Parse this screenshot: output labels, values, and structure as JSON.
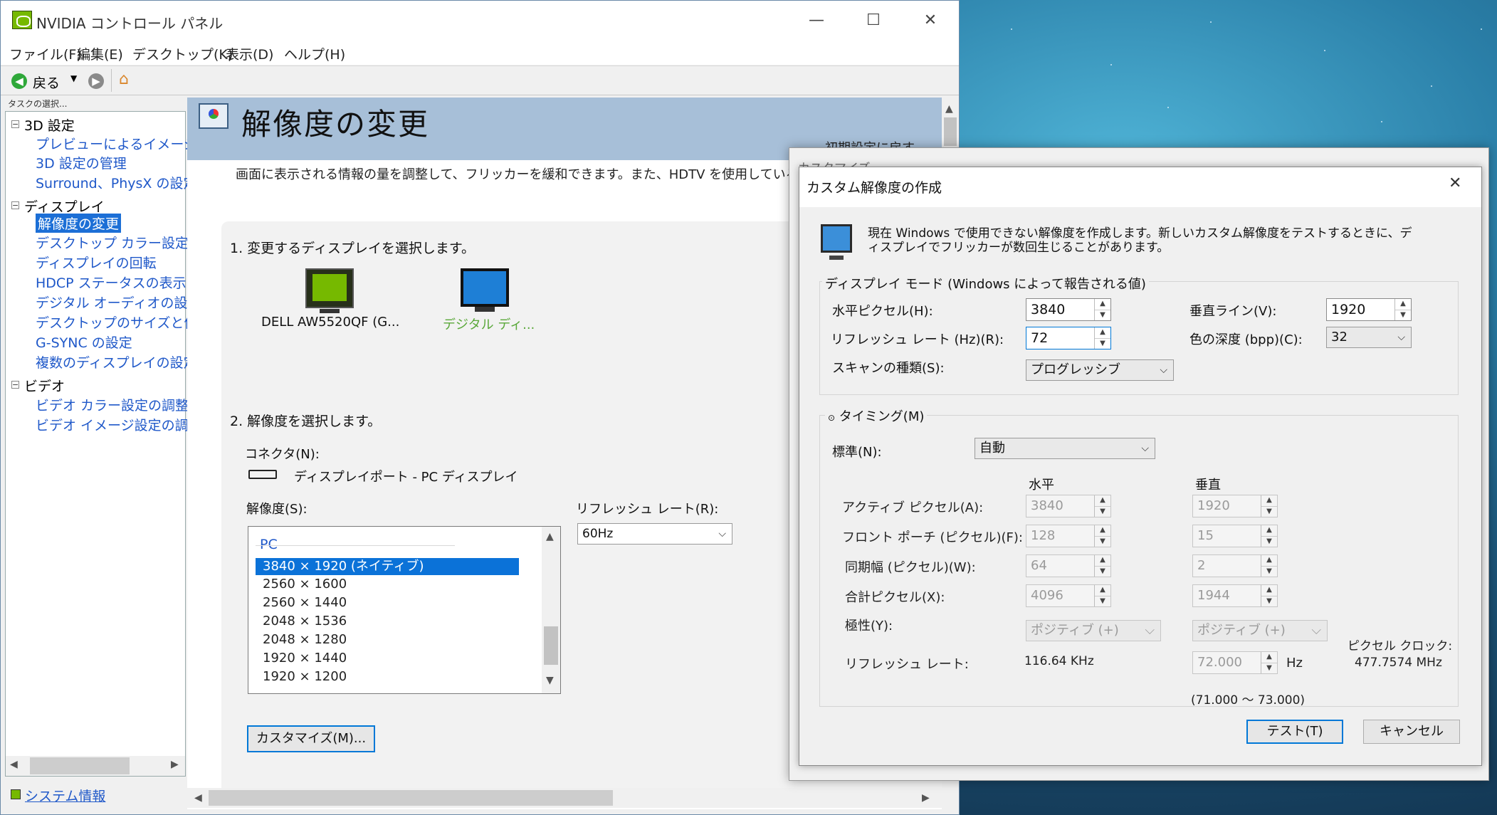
{
  "window": {
    "title": "NVIDIA コントロール パネル",
    "minimize": "—",
    "maximize": "☐",
    "close": "✕"
  },
  "menu": [
    "ファイル(F)",
    "編集(E)",
    "デスクトップ(K)",
    "表示(D)",
    "ヘルプ(H)"
  ],
  "toolbar": {
    "back": "戻る"
  },
  "sidebar": {
    "task_label": "タスクの選択...",
    "groups": [
      {
        "label": "3D 設定",
        "items": [
          "プレビューによるイメージ設",
          "3D 設定の管理",
          "Surround、PhysX の設定"
        ]
      },
      {
        "label": "ディスプレイ",
        "items": [
          "解像度の変更",
          "デスクトップ カラー設定の",
          "ディスプレイの回転",
          "HDCP ステータスの表示",
          "デジタル オーディオの設定",
          "デスクトップのサイズと位置",
          "G-SYNC の設定",
          "複数のディスプレイの設定"
        ]
      },
      {
        "label": "ビデオ",
        "items": [
          "ビデオ カラー設定の調整",
          "ビデオ イメージ設定の調整"
        ]
      }
    ],
    "system_info": "システム情報"
  },
  "page": {
    "title": "解像度の変更",
    "restore": "初期設定に戻す",
    "description": "画面に表示される情報の量を調整して、フリッカーを緩和できます。また、HDTV を使用している場",
    "step1": "1. 変更するディスプレイを選択します。",
    "displays": [
      "DELL AW5520QF (G...",
      "デジタル ディ..."
    ],
    "step2": "2. 解像度を選択します。",
    "connector_label": "コネクタ(N):",
    "connector_value": "ディスプレイポート - PC ディスプレイ",
    "resolution_label": "解像度(S):",
    "refresh_label": "リフレッシュ レート(R):",
    "refresh_value": "60Hz",
    "list_group": "PC",
    "resolutions": [
      "3840 × 1920 (ネイティブ)",
      "2560 × 1600",
      "2560 × 1440",
      "2048 × 1536",
      "2048 × 1280",
      "1920 × 1440",
      "1920 × 1200"
    ],
    "customize": "カスタマイズ(M)..."
  },
  "dialog_back_title": "カスタマイズ",
  "dialog": {
    "title": "カスタム解像度の作成",
    "info": "現在 Windows で使用できない解像度を作成します。新しいカスタム解像度をテストするときに、ディスプレイでフリッカーが数回生じることがあります。",
    "info_line1": "現在 Windows で使用できない解像度を作成します。新しいカスタム解像度をテストするときに、デ",
    "info_line2": "ィスプレイでフリッカーが数回生じることがあります。",
    "mode_group": "ディスプレイ モード (Windows によって報告される値)",
    "h_pixels_label": "水平ピクセル(H):",
    "h_pixels": "3840",
    "v_lines_label": "垂直ライン(V):",
    "v_lines": "1920",
    "refresh_label": "リフレッシュ レート (Hz)(R):",
    "refresh": "72",
    "depth_label": "色の深度 (bpp)(C):",
    "depth": "32",
    "scan_label": "スキャンの種類(S):",
    "scan": "プログレッシブ",
    "timing_label": "タイミング(M)",
    "standard_label": "標準(N):",
    "standard": "自動",
    "col_h": "水平",
    "col_v": "垂直",
    "active_label": "アクティブ ピクセル(A):",
    "active_h": "3840",
    "active_v": "1920",
    "front_label": "フロント ポーチ (ピクセル)(F):",
    "front_h": "128",
    "front_v": "15",
    "sync_label": "同期幅 (ピクセル)(W):",
    "sync_h": "64",
    "sync_v": "2",
    "total_label": "合計ピクセル(X):",
    "total_h": "4096",
    "total_v": "1944",
    "polarity_label": "極性(Y):",
    "polarity_h": "ポジティブ (+)",
    "polarity_v": "ポジティブ (+)",
    "pclk_label": "ピクセル クロック:",
    "pclk": "477.7574 MHz",
    "rr_label": "リフレッシュ レート:",
    "rr_h": "116.64 KHz",
    "rr_v": "72.000",
    "rr_unit": "Hz",
    "range": "(71.000 ～ 73.000)",
    "test": "テスト(T)",
    "cancel": "キャンセル"
  }
}
